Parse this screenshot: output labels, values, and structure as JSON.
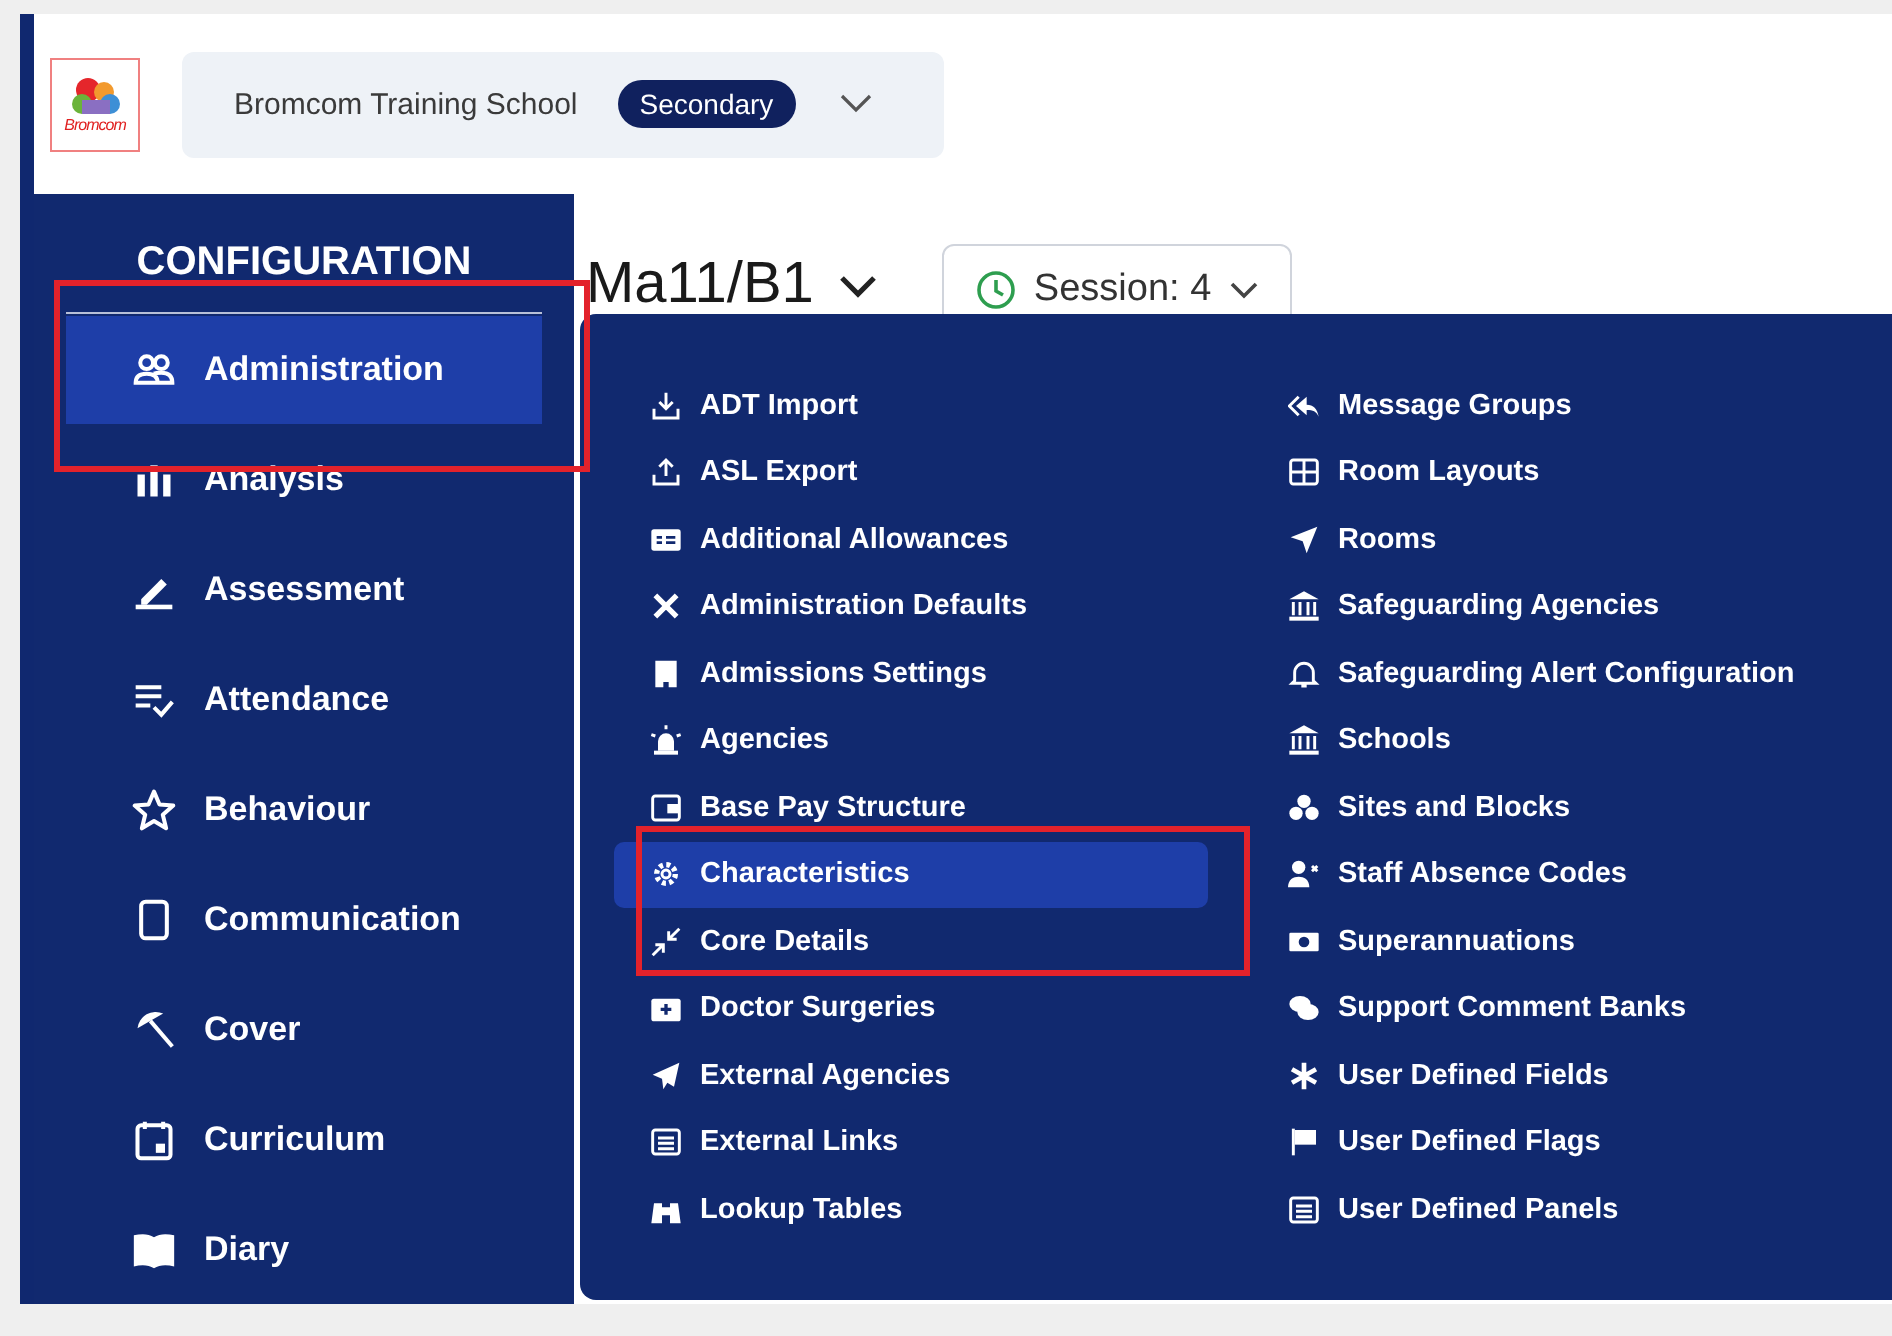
{
  "header": {
    "logo_text": "Bromcom",
    "school": "Bromcom Training School",
    "phase_badge": "Secondary"
  },
  "sidebar": {
    "heading": "CONFIGURATION",
    "items": [
      {
        "label": "Administration",
        "selected": true,
        "outlined": true
      },
      {
        "label": "Analysis",
        "selected": false,
        "outlined": false
      },
      {
        "label": "Assessment",
        "selected": false,
        "outlined": false
      },
      {
        "label": "Attendance",
        "selected": false,
        "outlined": false
      },
      {
        "label": "Behaviour",
        "selected": false,
        "outlined": false
      },
      {
        "label": "Communication",
        "selected": false,
        "outlined": false
      },
      {
        "label": "Cover",
        "selected": false,
        "outlined": false
      },
      {
        "label": "Curriculum",
        "selected": false,
        "outlined": false
      },
      {
        "label": "Diary",
        "selected": false,
        "outlined": false
      }
    ]
  },
  "page": {
    "title": "Ma11/B1",
    "session": "Session: 4"
  },
  "menu": {
    "columns": [
      [
        {
          "label": "ADT Import",
          "selected": false,
          "outlined": false
        },
        {
          "label": "ASL Export",
          "selected": false,
          "outlined": false
        },
        {
          "label": "Additional Allowances",
          "selected": false,
          "outlined": false
        },
        {
          "label": "Administration Defaults",
          "selected": false,
          "outlined": false
        },
        {
          "label": "Admissions Settings",
          "selected": false,
          "outlined": false
        },
        {
          "label": "Agencies",
          "selected": false,
          "outlined": false
        },
        {
          "label": "Base Pay Structure",
          "selected": false,
          "outlined": false
        },
        {
          "label": "Characteristics",
          "selected": true,
          "outlined": true
        },
        {
          "label": "Core Details",
          "selected": false,
          "outlined": true
        },
        {
          "label": "Doctor Surgeries",
          "selected": false,
          "outlined": false
        },
        {
          "label": "External Agencies",
          "selected": false,
          "outlined": false
        },
        {
          "label": "External Links",
          "selected": false,
          "outlined": false
        },
        {
          "label": "Lookup Tables",
          "selected": false,
          "outlined": false
        }
      ],
      [
        {
          "label": "Message Groups",
          "selected": false,
          "outlined": false
        },
        {
          "label": "Room Layouts",
          "selected": false,
          "outlined": false
        },
        {
          "label": "Rooms",
          "selected": false,
          "outlined": false
        },
        {
          "label": "Safeguarding Agencies",
          "selected": false,
          "outlined": false
        },
        {
          "label": "Safeguarding Alert Configuration",
          "selected": false,
          "outlined": false
        },
        {
          "label": "Schools",
          "selected": false,
          "outlined": false
        },
        {
          "label": "Sites and Blocks",
          "selected": false,
          "outlined": false
        },
        {
          "label": "Staff Absence Codes",
          "selected": false,
          "outlined": false
        },
        {
          "label": "Superannuations",
          "selected": false,
          "outlined": false
        },
        {
          "label": "Support Comment Banks",
          "selected": false,
          "outlined": false
        },
        {
          "label": "User Defined Fields",
          "selected": false,
          "outlined": false
        },
        {
          "label": "User Defined Flags",
          "selected": false,
          "outlined": false
        },
        {
          "label": "User Defined Panels",
          "selected": false,
          "outlined": false
        }
      ]
    ]
  }
}
